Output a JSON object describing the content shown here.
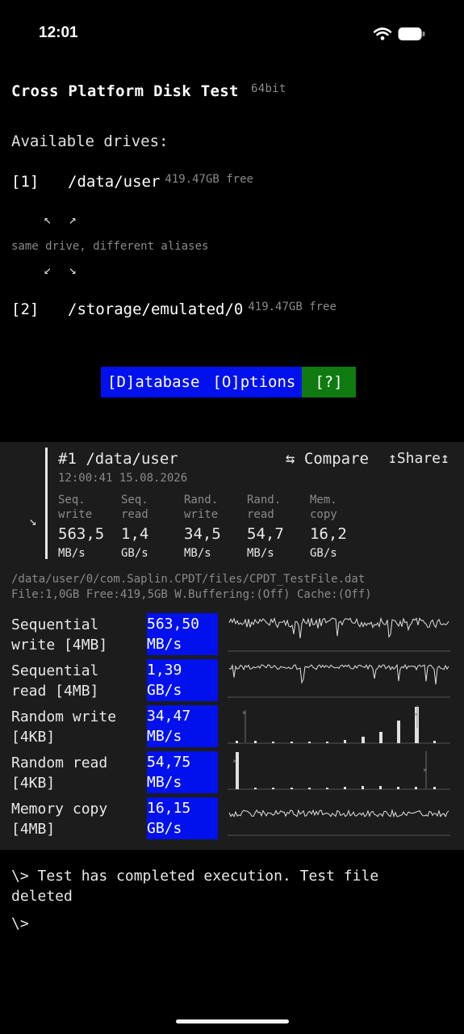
{
  "status_bar": {
    "time": "12:01",
    "icons": [
      "wifi-icon",
      "battery-icon"
    ]
  },
  "app": {
    "title": "Cross Platform Disk Test",
    "bits": "64bit"
  },
  "drives": {
    "heading": "Available drives:",
    "items": [
      {
        "index": "[1]",
        "path": "/data/user",
        "free": "419.47GB free"
      },
      {
        "index": "[2]",
        "path": "/storage/emulated/0",
        "free": "419.47GB free"
      }
    ],
    "arrows_top": "↖ ↗",
    "alias_note": "same drive, different aliases",
    "arrows_bottom": "↙ ↘"
  },
  "buttons": {
    "database": "[D]atabase",
    "options": "[O]ptions",
    "help": "[?]"
  },
  "summary": {
    "title": "#1 /data/user",
    "timestamp": "12:00:41 15.08.2026",
    "compare": "⇆ Compare",
    "share": "↥Share↥",
    "expand_arrow": "↘",
    "metrics": [
      {
        "label1": "Seq.",
        "label2": "write",
        "value": "563,5",
        "unit": "MB/s"
      },
      {
        "label1": "Seq.",
        "label2": "read",
        "value": "1,4",
        "unit": "GB/s"
      },
      {
        "label1": "Rand.",
        "label2": "write",
        "value": "34,5",
        "unit": "MB/s"
      },
      {
        "label1": "Rand.",
        "label2": "read",
        "value": "54,7",
        "unit": "MB/s"
      },
      {
        "label1": "Mem.",
        "label2": "copy",
        "value": "16,2",
        "unit": "GB/s"
      }
    ]
  },
  "file": {
    "path": "/data/user/0/com.Saplin.CPDT/files/CPDT_TestFile.dat",
    "info": "File:1,0GB Free:419,5GB W.Buffering:(Off) Cache:(Off)"
  },
  "tests": [
    {
      "name1": "Sequential",
      "name2": "write [4MB]",
      "value": "563,50",
      "unit": "MB/s"
    },
    {
      "name1": "Sequential",
      "name2": "read [4MB]",
      "value": "1,39",
      "unit": "GB/s"
    },
    {
      "name1": "Random write",
      "name2": "[4KB]",
      "value": "34,47",
      "unit": "MB/s"
    },
    {
      "name1": "Random read",
      "name2": "[4KB]",
      "value": "54,75",
      "unit": "MB/s"
    },
    {
      "name1": "Memory copy",
      "name2": "[4MB]",
      "value": "16,15",
      "unit": "GB/s"
    }
  ],
  "console": {
    "message": "\\> Test has completed execution. Test file deleted",
    "prompt": "\\>"
  },
  "colors": {
    "button_blue": "#0011ee",
    "button_green": "#0e7a10",
    "panel": "#1c1c1c"
  }
}
